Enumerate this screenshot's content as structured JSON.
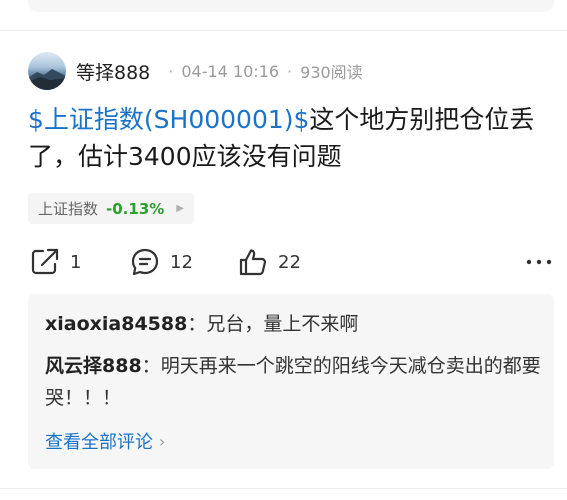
{
  "post": {
    "author": "等择888",
    "date": "04-14 10:16",
    "separator": "·",
    "reads": "930阅读",
    "stock_link": "$上证指数(SH000001)$",
    "text": "这个地方别把仓位丢了，估计3400应该没有问题"
  },
  "stock_chip": {
    "name": "上证指数",
    "change": "-0.13%",
    "change_color": "#2ca02c"
  },
  "actions": {
    "share_count": "1",
    "comment_count": "12",
    "like_count": "22"
  },
  "comments": [
    {
      "user": "xiaoxia84588",
      "text": "兄台，量上不来啊"
    },
    {
      "user": "风云择888",
      "text": "明天再来一个跳空的阳线今天减仓卖出的都要哭！！！"
    }
  ],
  "view_all_label": "查看全部评论",
  "colors": {
    "link": "#1a73c9",
    "card_bg": "#f6f6f7"
  }
}
